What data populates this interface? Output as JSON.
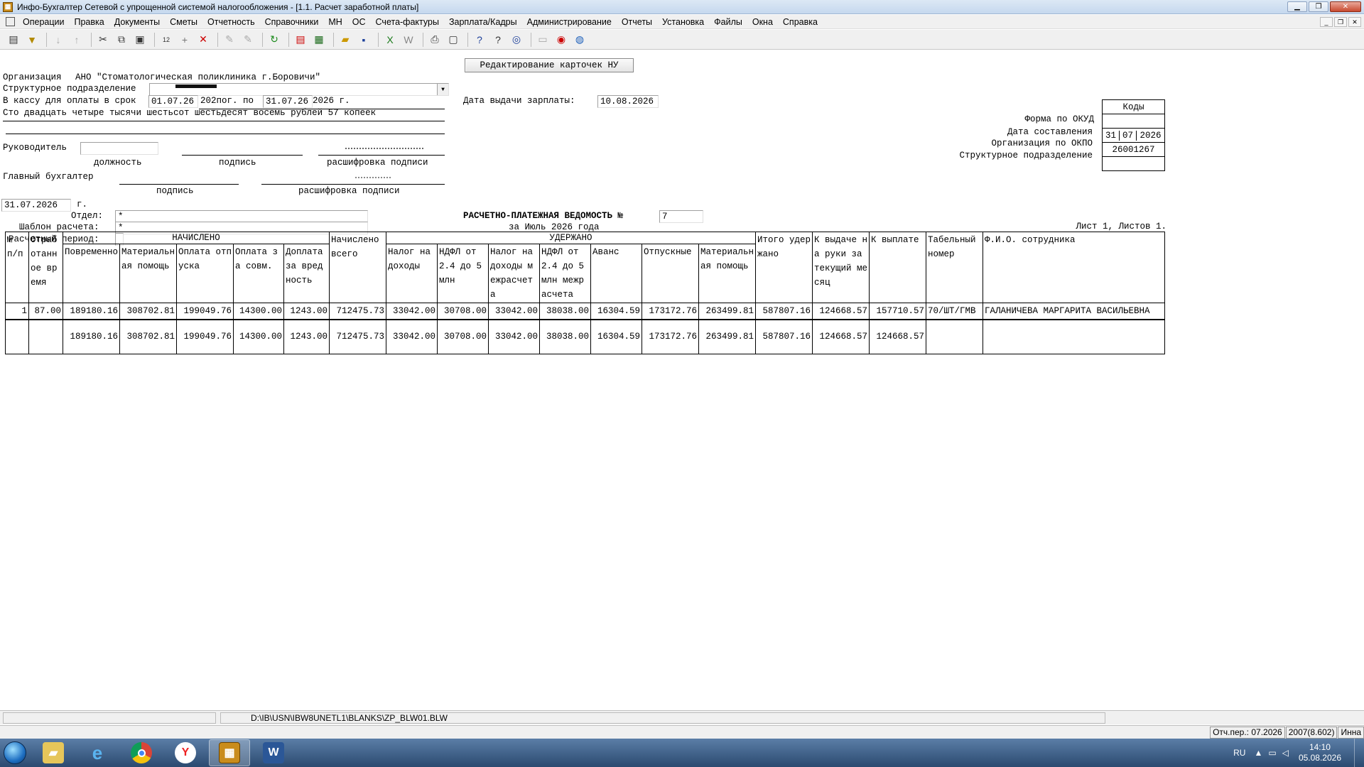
{
  "window": {
    "title": "Инфо-Бухгалтер Сетевой с упрощенной системой налогообложения - [1.1. Расчет заработной платы]"
  },
  "menu": [
    "Операции",
    "Правка",
    "Документы",
    "Сметы",
    "Отчетность",
    "Справочники",
    "МН",
    "ОС",
    "Счета-фактуры",
    "Зарплата/Кадры",
    "Администрирование",
    "Отчеты",
    "Установка",
    "Файлы",
    "Окна",
    "Справка"
  ],
  "header_button": "Редактирование карточек НУ",
  "form": {
    "org_label": "Организация",
    "org_value": "АНО \"Стоматологическая поликлиника г.Боровичи\"",
    "subdiv_label": "Структурное подразделение",
    "cash_label": "В кассу для оплаты в срок",
    "date_from": "01.07.26",
    "year_mid": "202пог. по",
    "date_to": "31.07.26",
    "year_end": "2026 г.",
    "amount_words": "Сто двадцать четыре тысячи шестьсот шестьдесят восемь рублей 57 копеек",
    "pay_date_label": "Дата выдачи зарплаты:",
    "pay_date": "10.08.2026",
    "head_label": "Руководитель",
    "cap_position": "должность",
    "cap_signature": "подпись",
    "cap_decode": "расшифровка подписи",
    "chief_label": "Главный бухгалтер",
    "cap_signature2": "подпись",
    "cap_decode2": "расшифровка подписи",
    "doc_date": "31.07.2026",
    "doc_date_suffix": "г.",
    "dept_label": "Отдел:",
    "dept_value": "*",
    "template_label": "Шаблон расчета:",
    "template_value": "*",
    "period_label": "Расчетный период:",
    "statement_title": "РАСЧЕТНО-ПЛАТЕЖНАЯ ВЕДОМОСТЬ №",
    "statement_no": "7",
    "statement_period": "за Июль 2026 года",
    "sheet_info": "Лист 1, Листов 1."
  },
  "codes": {
    "header": "Коды",
    "okud_label": "Форма по ОКУД",
    "okud_value": "",
    "date_label": "Дата составления",
    "date_d": "31",
    "date_m": "07",
    "date_y": "2026",
    "okpo_label": "Организация по ОКПО",
    "okpo_value": "26001267",
    "subdiv_label": "Структурное подразделение",
    "subdiv_value": ""
  },
  "table": {
    "h_no": "№ п/п",
    "h_worked": "Отработанное время",
    "h_accrued_group": "НАЧИСЛЕНО",
    "h_accrued_total": "Начислено всего",
    "h_withheld_group": "УДЕРЖАНО",
    "h_total_withheld": "Итого удержано",
    "h_to_pay_month": "К выдаче на руки за текущий месяц",
    "h_to_pay": "К выплате",
    "h_tab": "Табельный номер",
    "h_fio": "Ф.И.О. сотрудника",
    "accrued_cols": [
      "Повременно",
      "Материальная помощь",
      "Оплата отпуска",
      "Оплата за совм.",
      "Доплата за вредность"
    ],
    "withheld_cols": [
      "Налог на доходы",
      "НДФЛ от 2.4 до 5 млн",
      "Налог на доходы межрасчета",
      "НДФЛ от 2.4 до 5 млн межрасчета",
      "Аванс",
      "Отпускные",
      "Материальная помощь"
    ],
    "row": {
      "no": "1",
      "worked": "87.00",
      "a1": "189180.16",
      "a2": "308702.81",
      "a3": "199049.76",
      "a4": "14300.00",
      "a5": "1243.00",
      "atotal": "712475.73",
      "w1": "33042.00",
      "w2": "30708.00",
      "w3": "33042.00",
      "w4": "38038.00",
      "w5": "16304.59",
      "w6": "173172.76",
      "w7": "263499.81",
      "wtotal": "587807.16",
      "pay_month": "124668.57",
      "pay": "157710.57",
      "tab": "70/ШТ/ГМВ",
      "fio": "ГАЛАНИЧЕВА МАРГАРИТА ВАСИЛЬЕВНА"
    },
    "total": {
      "a1": "189180.16",
      "a2": "308702.81",
      "a3": "199049.76",
      "a4": "14300.00",
      "a5": "1243.00",
      "atotal": "712475.73",
      "w1": "33042.00",
      "w2": "30708.00",
      "w3": "33042.00",
      "w4": "38038.00",
      "w5": "16304.59",
      "w6": "173172.76",
      "w7": "263499.81",
      "wtotal": "587807.16",
      "pay_month": "124668.57",
      "pay": "124668.57"
    }
  },
  "status": {
    "path": "D:\\IB\\USN\\IBW8UNETL1\\BLANKS\\ZP_BLW01.BLW",
    "period": "Отч.пер.: 07.2026",
    "version": "2007(8.602)",
    "user": "Инна"
  },
  "tray": {
    "lang": "RU",
    "time": "14:10",
    "date": "05.08.2026"
  }
}
